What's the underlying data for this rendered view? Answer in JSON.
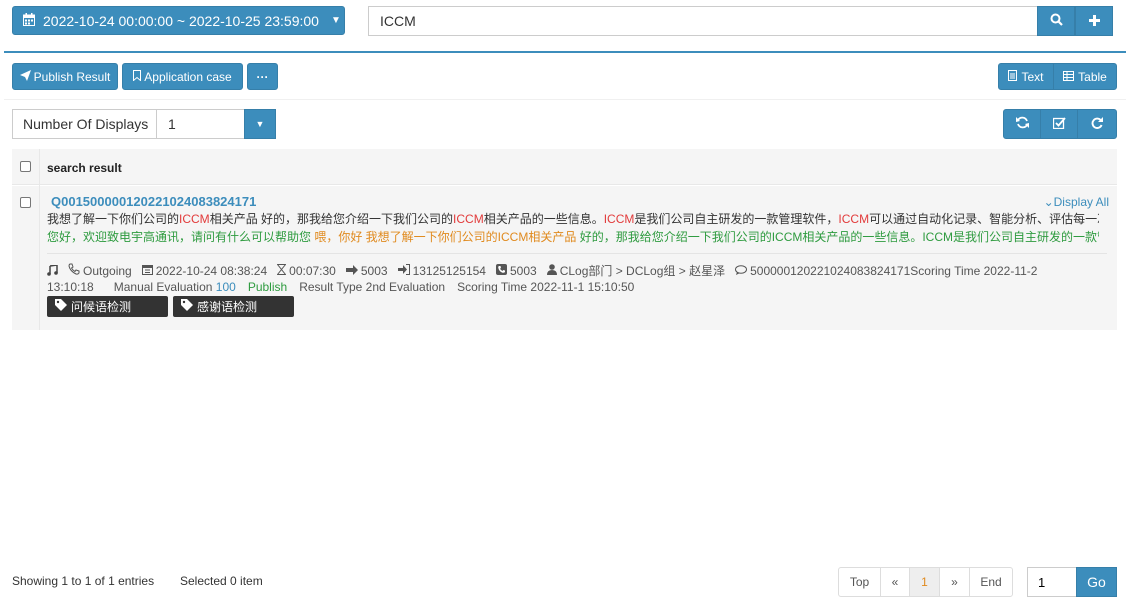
{
  "header": {
    "date_range": "2022-10-24 00:00:00 ~ 2022-10-25 23:59:00",
    "search_value": "ICCM"
  },
  "toolbar": {
    "publish_label": "Publish Result",
    "application_label": "Application case",
    "more_label": "···",
    "text_label": "Text",
    "table_label": "Table"
  },
  "displays": {
    "label": "Number Of Displays",
    "value": "1"
  },
  "table": {
    "header": "search result"
  },
  "result": {
    "id": "Q0015000001202210240838241​71",
    "display_all": "Display All",
    "line1": [
      {
        "t": "我想了解一下你们公司的",
        "c": ""
      },
      {
        "t": "ICCM",
        "c": "red"
      },
      {
        "t": "相关产品 好的，那我给您介绍一下我们公司的",
        "c": ""
      },
      {
        "t": "ICCM",
        "c": "red"
      },
      {
        "t": "相关产品的一些信息。",
        "c": ""
      },
      {
        "t": "ICCM",
        "c": "red"
      },
      {
        "t": "是我们公司自主研发的一款管理软件，",
        "c": ""
      },
      {
        "t": "ICCM",
        "c": "red"
      },
      {
        "t": "可以通过自动化记录、智能分析、评估每一次...",
        "c": ""
      }
    ],
    "line2": [
      {
        "t": "您好，欢迎致电宇高通讯，请问有什么可以帮助您 ",
        "c": "green"
      },
      {
        "t": "喂，你好 我想了解一下你们公司的ICCM相关产品 ",
        "c": "orange"
      },
      {
        "t": "好的，那我给您介绍一下我们公司的ICCM相关产品的一些信息。ICCM是我们公司自主研发的一款管...",
        "c": "green"
      }
    ],
    "meta": {
      "direction": "Outgoing",
      "datetime": "2022-10-24 08:38:24",
      "duration": "00:07:30",
      "extension": "5003",
      "phone": "13125125154",
      "agent_no": "5003",
      "org": "CLog部门 > DCLog组 > 赵星泽",
      "session": "500000120221024083824171Scoring Time 2022-11-2",
      "time_cont": "13:10:18",
      "manual_label": "Manual Evaluation",
      "manual_score": "100",
      "publish_status": "Publish",
      "result_type": "Result Type 2nd Evaluation",
      "scoring_time": "Scoring Time 2022-11-1 15:10:50"
    },
    "tags": [
      "问候语检测",
      "感谢语检测"
    ]
  },
  "footer": {
    "showing": "Showing 1 to 1 of 1 entries",
    "selected": "Selected 0 item",
    "top": "Top",
    "prev": "«",
    "page": "1",
    "next": "»",
    "end": "End",
    "goto_value": "1",
    "go_label": "Go"
  }
}
